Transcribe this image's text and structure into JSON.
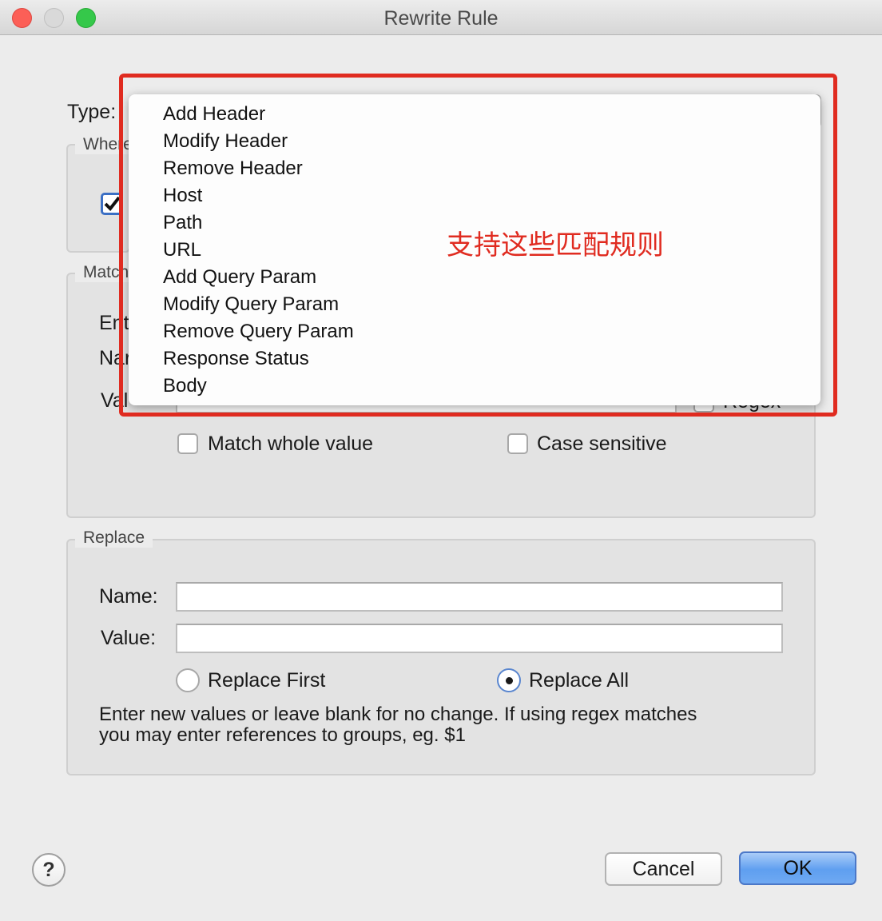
{
  "window": {
    "title": "Rewrite Rule"
  },
  "type_section": {
    "label": "Type:"
  },
  "where_group": {
    "legend": "Where"
  },
  "match_group": {
    "legend": "Match",
    "enter_label": "Ent",
    "name_label": "Nar",
    "value_label": "Val",
    "regex_label": "Regex",
    "match_whole_value": "Match whole value",
    "case_sensitive": "Case sensitive"
  },
  "replace_group": {
    "legend": "Replace",
    "name_label": "Name:",
    "value_label": "Value:",
    "replace_first": "Replace First",
    "replace_all": "Replace All",
    "help_text_line1": "Enter new values or leave blank for no change. If using regex matches",
    "help_text_line2": "you may enter references to groups, eg. $1"
  },
  "type_dropdown": {
    "options": [
      "Add Header",
      "Modify Header",
      "Remove Header",
      "Host",
      "Path",
      "URL",
      "Add Query Param",
      "Modify Query Param",
      "Remove Query Param",
      "Response Status",
      "Body"
    ]
  },
  "annotation": {
    "text": "支持这些匹配规则",
    "color": "#e02b20"
  },
  "buttons": {
    "help": "?",
    "cancel": "Cancel",
    "ok": "OK"
  }
}
